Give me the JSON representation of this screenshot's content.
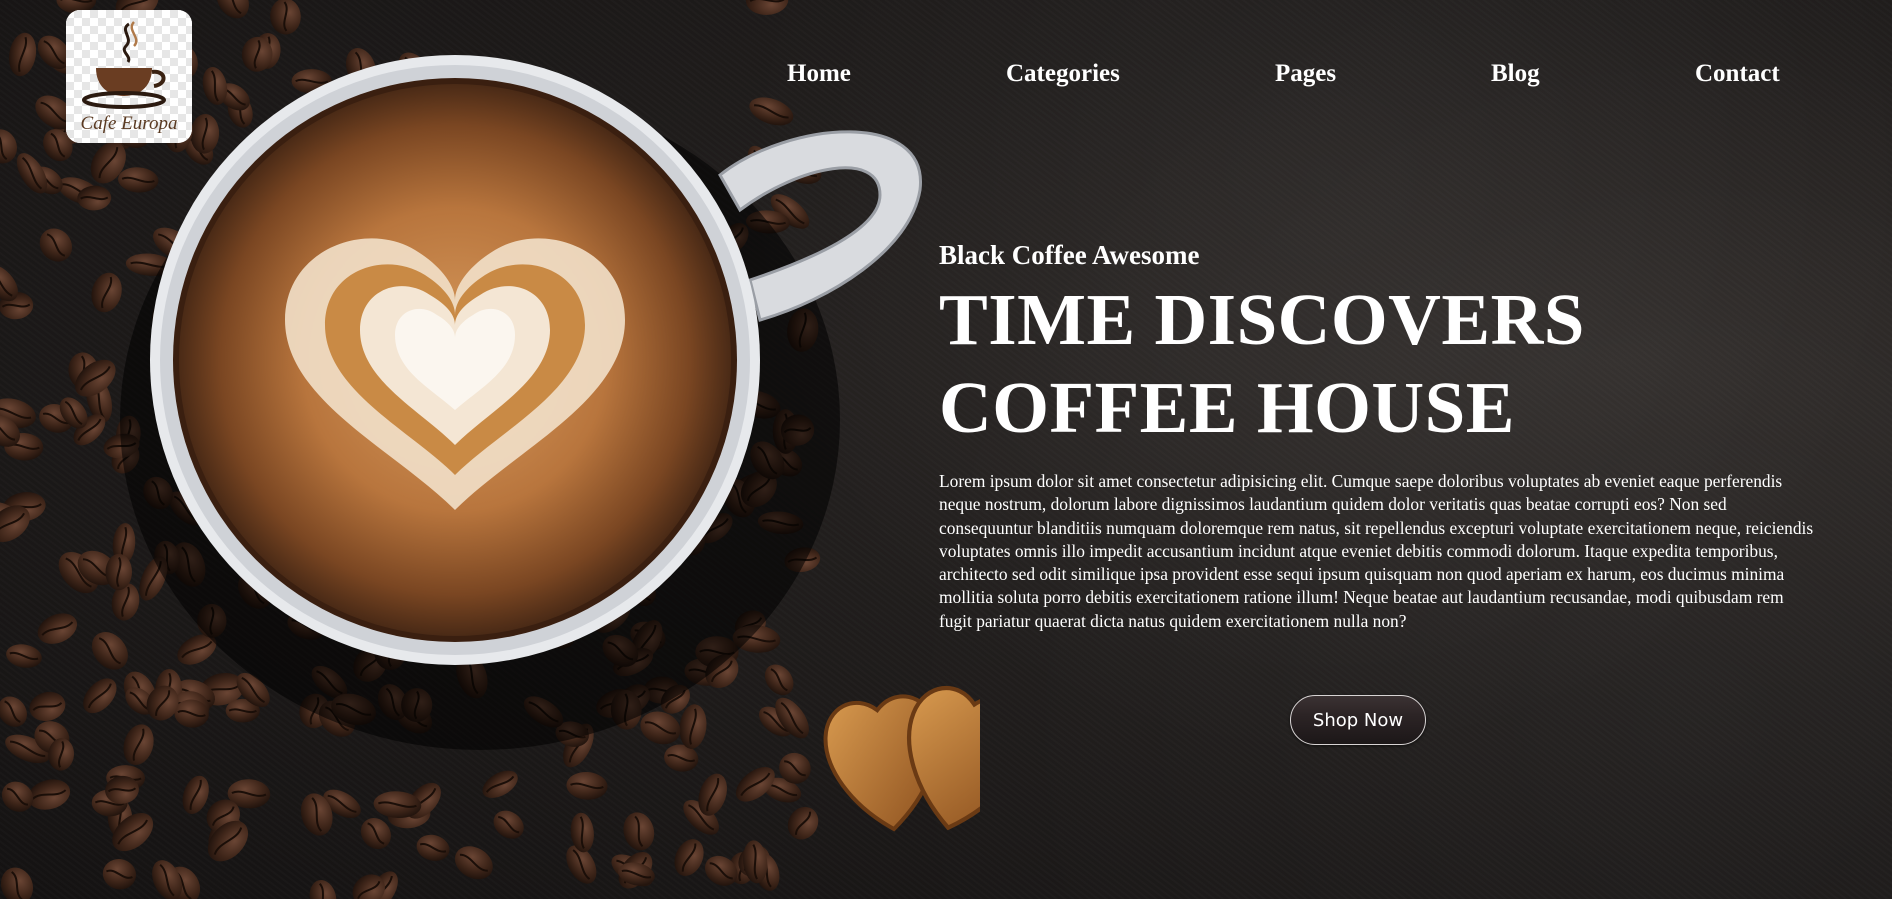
{
  "logo": {
    "brand": "Cafe Europa"
  },
  "nav": {
    "items": [
      "Home",
      "Categories",
      "Pages",
      "Blog",
      "Contact"
    ]
  },
  "hero": {
    "eyebrow": "Black Coffee Awesome",
    "title_line1": "TIME DISCOVERS",
    "title_line2": "COFFEE HOUSE",
    "paragraph": "Lorem ipsum dolor sit amet consectetur adipisicing elit. Cumque saepe doloribus voluptates ab eveniet eaque perferendis neque nostrum, dolorum labore dignissimos laudantium quidem dolor veritatis quas beatae corrupti eos? Non sed consequuntur blanditiis numquam doloremque rem natus, sit repellendus excepturi voluptate exercitationem neque, reiciendis voluptates omnis illo impedit accusantium incidunt atque eveniet debitis commodi dolorum. Itaque expedita temporibus, architecto sed odit similique ipsa provident esse sequi ipsum quisquam non quod aperiam ex harum, eos ducimus minima mollitia soluta porro debitis exercitationem ratione illum! Neque beatae aut laudantium recusandae, modi quibusdam rem fugit pariatur quaerat dicta natus quidem exercitationem nulla non?",
    "cta": "Shop Now"
  },
  "colors": {
    "background": "#201d1c",
    "accent": "#c98a45",
    "bean": "#3b2419",
    "text": "#ffffff"
  }
}
